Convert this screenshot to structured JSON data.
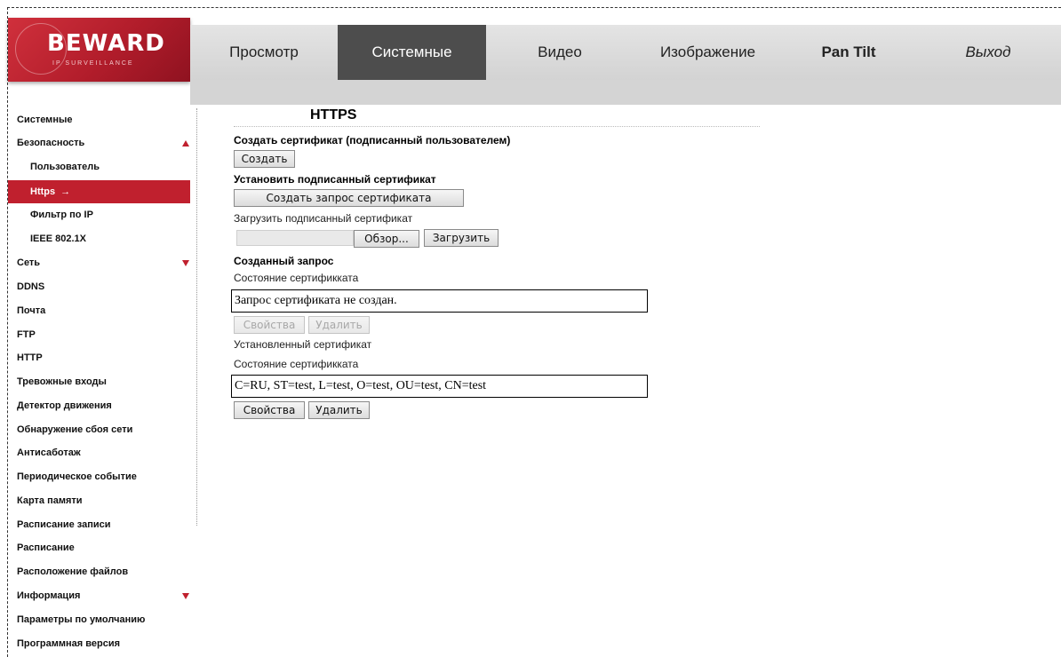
{
  "brand": {
    "name": "BEWARD",
    "tagline": "IP SURVEILLANCE",
    "accent": "#c0202e"
  },
  "topnav": {
    "items": [
      {
        "label": "Просмотр"
      },
      {
        "label": "Системные",
        "active": true
      },
      {
        "label": "Видео"
      },
      {
        "label": "Изображение"
      },
      {
        "label": "Pan Tilt"
      },
      {
        "label": "Выход"
      }
    ]
  },
  "sidebar": {
    "items": [
      {
        "label": "Системные"
      },
      {
        "label": "Безопасность",
        "expanded": true
      },
      {
        "label": "Пользователь"
      },
      {
        "label": "Https",
        "active": true,
        "arrow": "→"
      },
      {
        "label": "Фильтр по IP"
      },
      {
        "label": "IEEE 802.1X"
      },
      {
        "label": "Сеть",
        "collapsed": true
      },
      {
        "label": "DDNS"
      },
      {
        "label": "Почта"
      },
      {
        "label": "FTP"
      },
      {
        "label": "HTTP"
      },
      {
        "label": "Тревожные входы"
      },
      {
        "label": "Детектор движения"
      },
      {
        "label": "Обнаружение сбоя сети"
      },
      {
        "label": "Антисаботаж"
      },
      {
        "label": "Периодическое событие"
      },
      {
        "label": "Карта памяти"
      },
      {
        "label": "Расписание записи"
      },
      {
        "label": "Расписание"
      },
      {
        "label": "Расположение файлов"
      },
      {
        "label": "Информация",
        "collapsed": true
      },
      {
        "label": "Параметры по умолчанию"
      },
      {
        "label": "Программная версия"
      }
    ]
  },
  "main": {
    "title": "HTTPS",
    "create_cert_heading": "Создать сертификат (подписанный пользователем)",
    "create_button": "Создать",
    "install_signed_heading": "Установить подписанный сертификат",
    "create_request_button": "Создать запрос сертификата",
    "upload_signed_label": "Загрузить подписанный сертификат",
    "browse_button": "Обзор...",
    "upload_button": "Загрузить",
    "created_request_heading": "Созданный запрос",
    "request_status_label": "Состояние сертификката",
    "request_status_value": "Запрос сертификата не создан.",
    "request_properties_button": "Свойства",
    "request_delete_button": "Удалить",
    "installed_cert_label": "Установленный сертификат",
    "installed_status_label": "Состояние сертификката",
    "installed_status_value": "C=RU, ST=test, L=test, O=test, OU=test, CN=test",
    "installed_properties_button": "Свойства",
    "installed_delete_button": "Удалить"
  }
}
